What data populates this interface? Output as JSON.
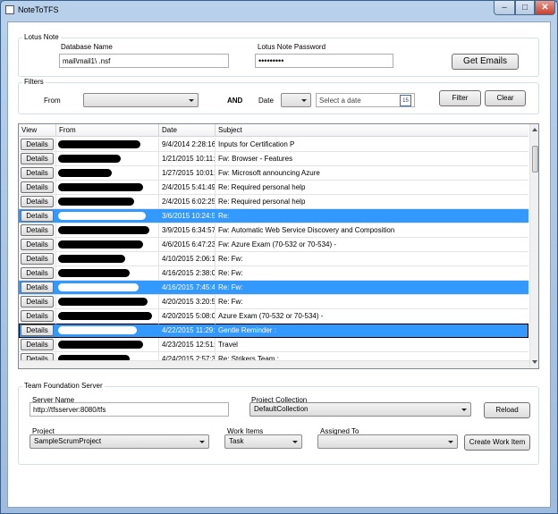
{
  "window": {
    "title": "NoteToTFS",
    "minimize": "–",
    "maximize": "□",
    "close": "✕"
  },
  "lotus": {
    "group_title": "Lotus Note",
    "db_label": "Database Name",
    "db_value": "mail\\mail1\\              .nsf",
    "pwd_label": "Lotus Note Password",
    "pwd_value": "•••••••••",
    "get_emails": "Get Emails"
  },
  "filters": {
    "group_title": "Filters",
    "from_label": "From",
    "from_value": "",
    "and_label": "AND",
    "date_label": "Date",
    "date_op_value": "",
    "date_placeholder": "Select a date",
    "calendar_glyph": "15",
    "filter_btn": "Filter",
    "clear_btn": "Clear"
  },
  "grid": {
    "columns": [
      "View",
      "From",
      "Date",
      "Subject"
    ],
    "details_label": "Details",
    "rows": [
      {
        "date": "9/4/2014 2:28:16",
        "subject": "Inputs for Certification P",
        "selected": false
      },
      {
        "date": "1/21/2015 10:11:2",
        "subject": "Fw:              Browser - Features",
        "selected": false
      },
      {
        "date": "1/27/2015 10:01:4",
        "subject": "Fw: Microsoft announcing Azure",
        "selected": false
      },
      {
        "date": "2/4/2015 5:41:49",
        "subject": "Re: Required personal help",
        "selected": false
      },
      {
        "date": "2/4/2015 6:02:25",
        "subject": "Re: Required personal help",
        "selected": false
      },
      {
        "date": "3/6/2015 10:24:54",
        "subject": "Re:",
        "selected": true
      },
      {
        "date": "3/9/2015 6:34:57",
        "subject": "Fw: Automatic Web Service Discovery and Composition",
        "selected": false
      },
      {
        "date": "4/6/2015 6:47:23",
        "subject": "Fw: Azure Exam (70-532 or 70-534) -",
        "selected": false
      },
      {
        "date": "4/10/2015 2:06:14",
        "subject": "Re: Fw:",
        "selected": false
      },
      {
        "date": "4/16/2015 2:38:03",
        "subject": "Re: Fw:",
        "selected": false
      },
      {
        "date": "4/16/2015 7:45:46",
        "subject": "Re: Fw:",
        "selected": true
      },
      {
        "date": "4/20/2015 3:20:50",
        "subject": "Re: Fw:",
        "selected": false
      },
      {
        "date": "4/20/2015 5:08:05",
        "subject": "Azure Exam (70-532 or 70-534) -",
        "selected": false
      },
      {
        "date": "4/22/2015 11:29:3",
        "subject": "Gentle Reminder :",
        "selected": true
      },
      {
        "date": "4/23/2015 12:51:0",
        "subject": "Travel",
        "selected": false
      },
      {
        "date": "4/24/2015 2:57:31",
        "subject": "Re: Strikers Team :",
        "selected": false
      }
    ]
  },
  "tfs": {
    "group_title": "Team Foundation Server",
    "server_label": "Server Name",
    "server_value": "http://tfsserver:8080/tfs",
    "collection_label": "Project Collection",
    "collection_value": "DefaultCollection",
    "reload_btn": "Reload",
    "project_label": "Project",
    "project_value": "SampleScrumProject",
    "workitems_label": "Work Items",
    "workitems_value": "Task",
    "assigned_label": "Assigned To",
    "assigned_value": "",
    "create_btn": "Create Work Item"
  }
}
